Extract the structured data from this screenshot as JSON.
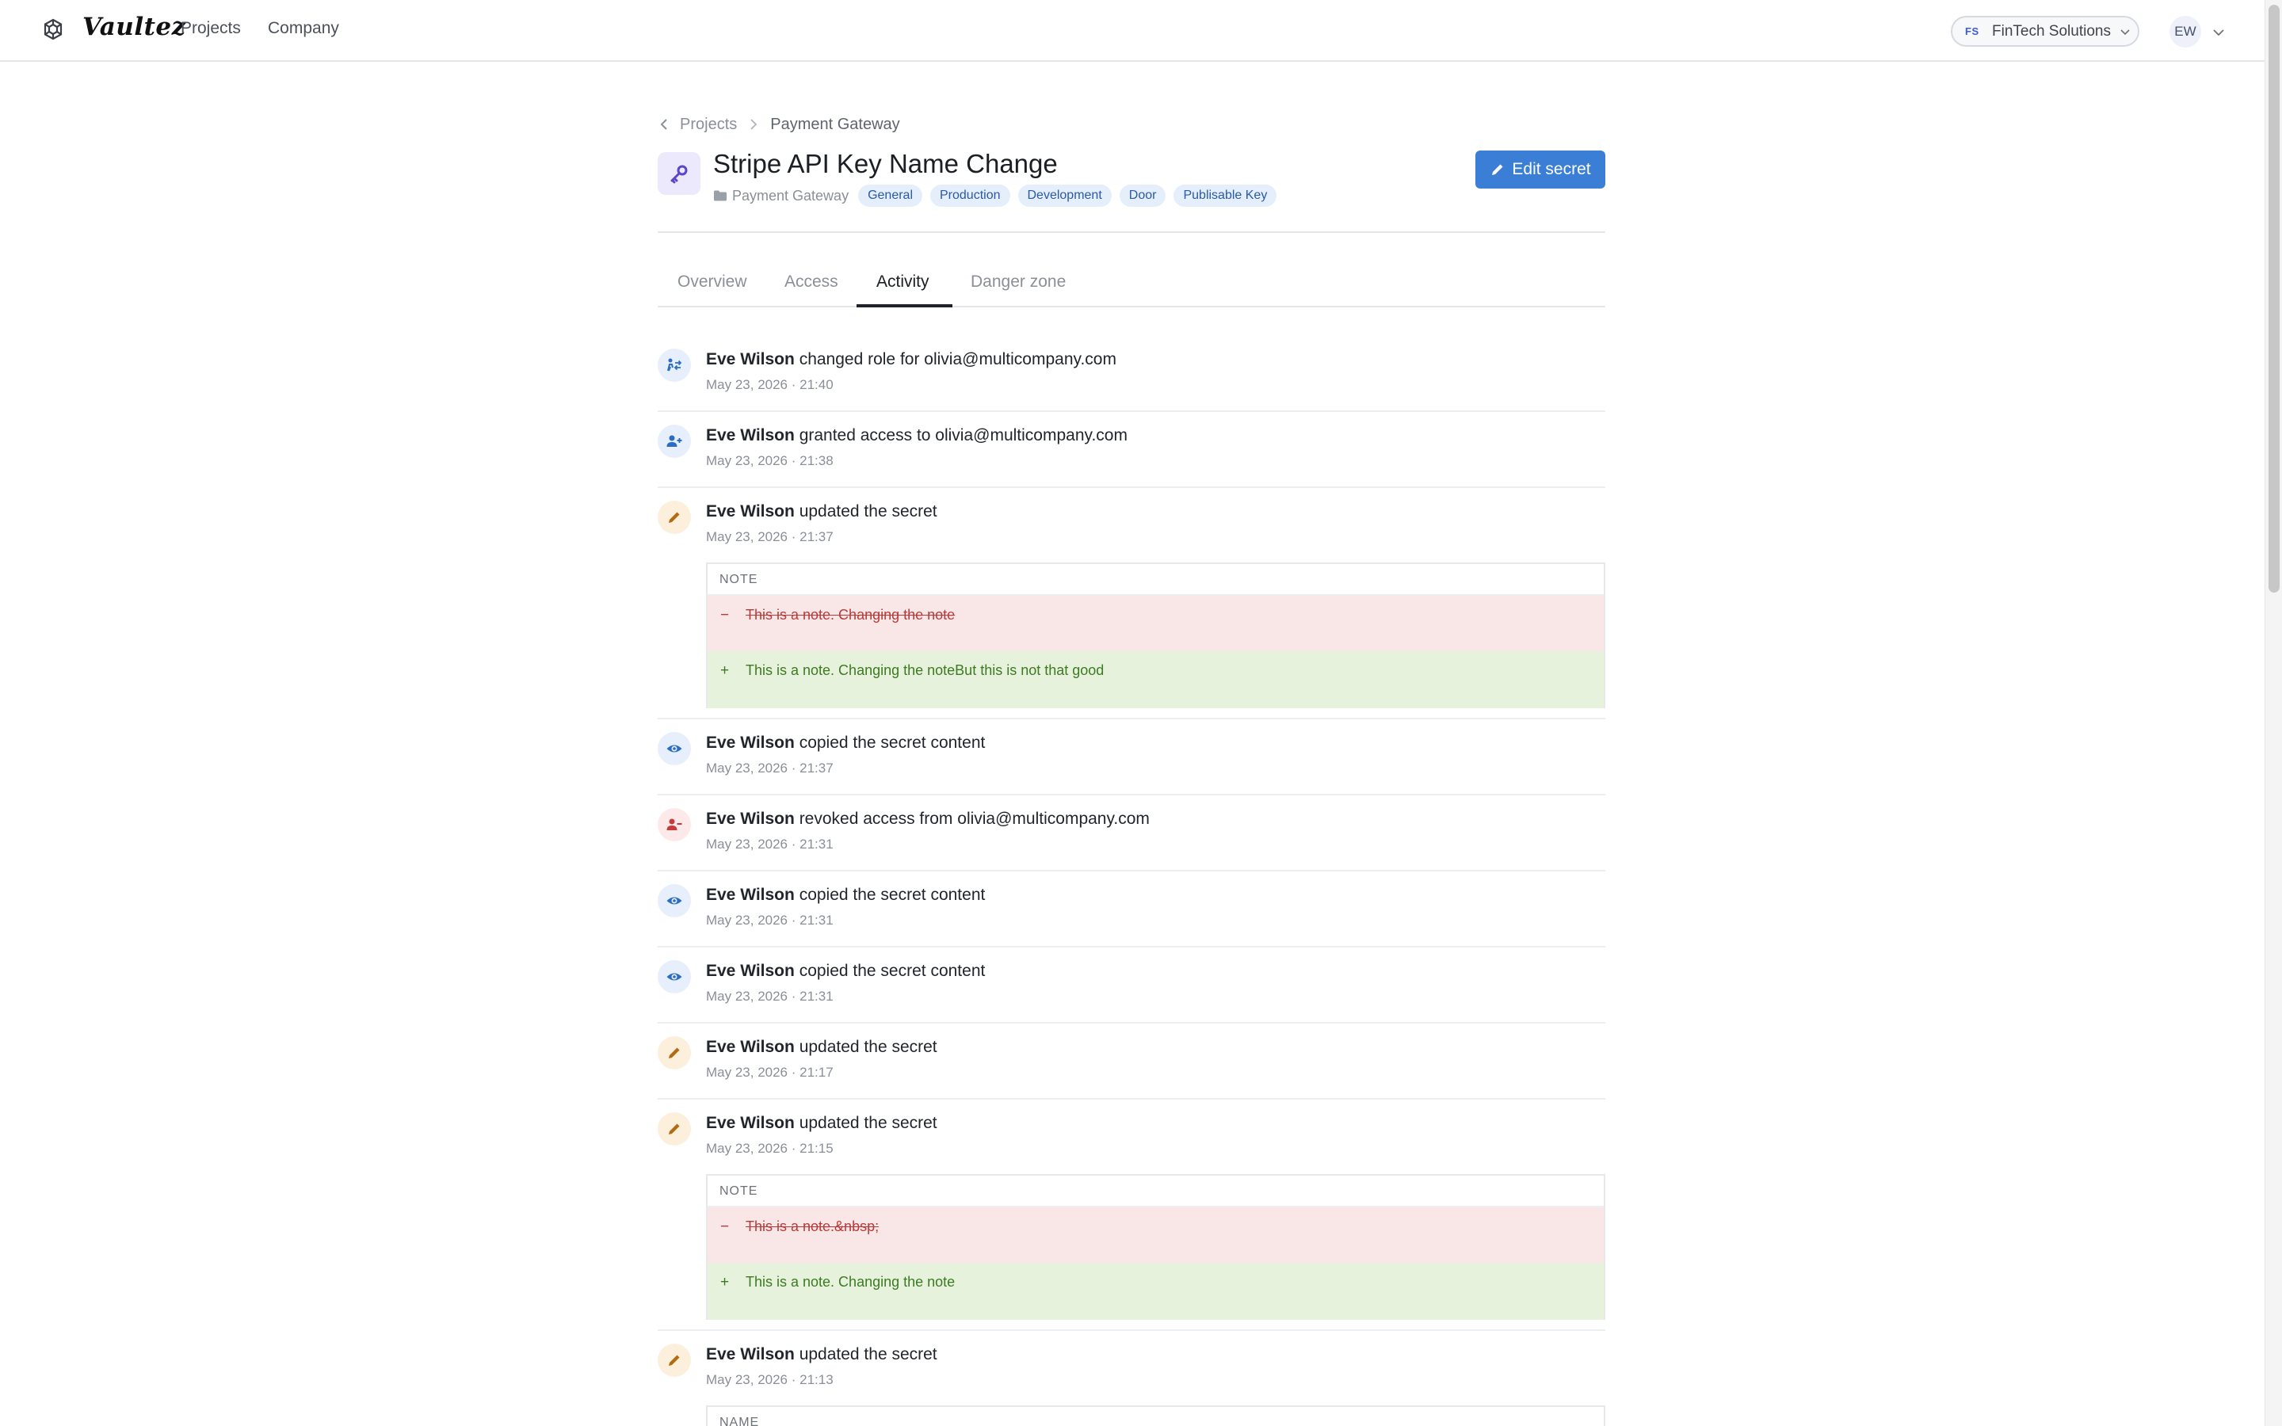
{
  "app": {
    "name": "Vaultez"
  },
  "nav": {
    "projects": "Projects",
    "company": "Company"
  },
  "org": {
    "initials": "FS",
    "name": "FinTech Solutions"
  },
  "user": {
    "initials": "EW"
  },
  "breadcrumb": {
    "parent": "Projects",
    "current": "Payment Gateway"
  },
  "secret": {
    "title": "Stripe API Key Name Change",
    "folder": "Payment Gateway",
    "tags": [
      "General",
      "Production",
      "Development",
      "Door",
      "Publisable Key"
    ]
  },
  "actions": {
    "edit": "Edit secret"
  },
  "tabs": [
    "Overview",
    "Access",
    "Activity",
    "Danger zone"
  ],
  "active_tab": "Activity",
  "activity": [
    {
      "icon": "role-change-icon",
      "actor": "Eve Wilson",
      "action": "changed role for olivia@multicompany.com",
      "time": "May 23, 2026 · 21:40"
    },
    {
      "icon": "user-add-icon",
      "actor": "Eve Wilson",
      "action": "granted access to olivia@multicompany.com",
      "time": "May 23, 2026 · 21:38"
    },
    {
      "icon": "pencil-icon",
      "actor": "Eve Wilson",
      "action": "updated the secret",
      "time": "May 23, 2026 · 21:37",
      "diff": {
        "field": "NOTE",
        "removed": "This is a note. Changing the note",
        "added": "This is a note. Changing the noteBut this is not that good"
      }
    },
    {
      "icon": "eye-icon",
      "actor": "Eve Wilson",
      "action": "copied the secret content",
      "time": "May 23, 2026 · 21:37"
    },
    {
      "icon": "user-remove-icon",
      "actor": "Eve Wilson",
      "action": "revoked access from olivia@multicompany.com",
      "time": "May 23, 2026 · 21:31"
    },
    {
      "icon": "eye-icon",
      "actor": "Eve Wilson",
      "action": "copied the secret content",
      "time": "May 23, 2026 · 21:31"
    },
    {
      "icon": "eye-icon",
      "actor": "Eve Wilson",
      "action": "copied the secret content",
      "time": "May 23, 2026 · 21:31"
    },
    {
      "icon": "pencil-icon",
      "actor": "Eve Wilson",
      "action": "updated the secret",
      "time": "May 23, 2026 · 21:17"
    },
    {
      "icon": "pencil-icon",
      "actor": "Eve Wilson",
      "action": "updated the secret",
      "time": "May 23, 2026 · 21:15",
      "diff": {
        "field": "NOTE",
        "removed": "This is a note.&nbsp;",
        "added": "This is a note. Changing the note"
      }
    },
    {
      "icon": "pencil-icon",
      "actor": "Eve Wilson",
      "action": "updated the secret",
      "time": "May 23, 2026 · 21:13",
      "diff": {
        "field": "NAME"
      }
    }
  ],
  "diff_signs": {
    "removed": "−",
    "added": "+"
  },
  "colors": {
    "primary": "#3a7fd5",
    "tag_bg": "#e5eefb",
    "tag_text": "#2a5aa8",
    "removed_bg": "#f9e6e6",
    "added_bg": "#e6f2dc"
  }
}
